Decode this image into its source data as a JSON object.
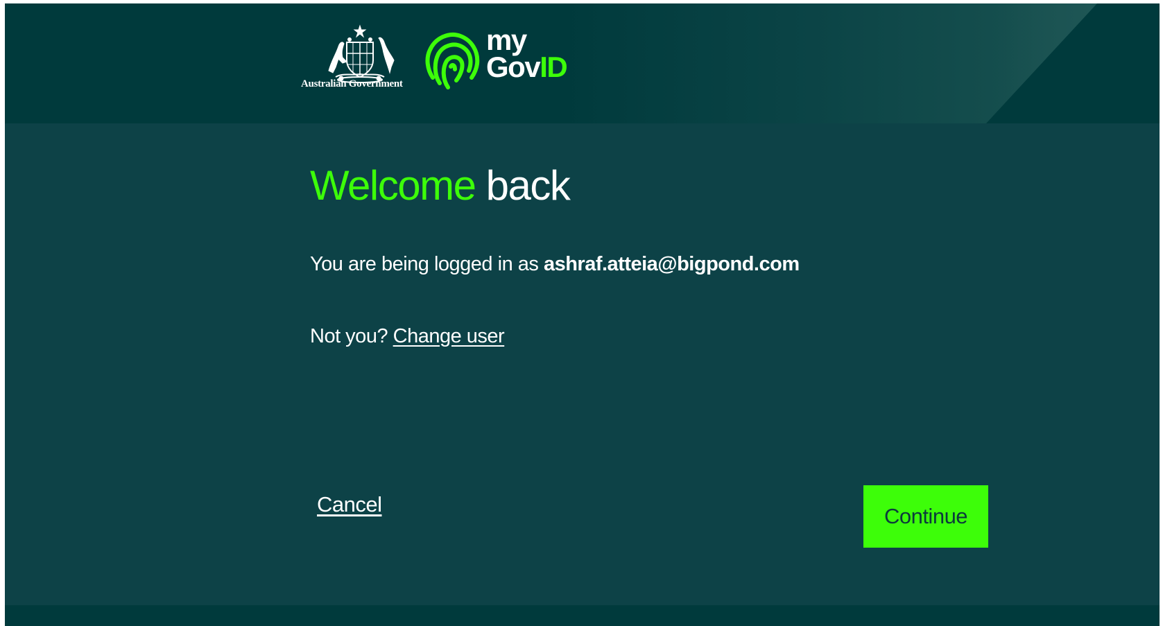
{
  "header": {
    "gov_logo_text": "Australian Government",
    "brand": {
      "my": "my",
      "gov": "Gov",
      "id": "ID"
    },
    "icons": [
      "coat-of-arms-icon",
      "fingerprint-icon"
    ]
  },
  "welcome": {
    "title_green": "Welcome",
    "title_white": "back",
    "logged_prefix": "You are being logged in as",
    "email": "ashraf.atteia@bigpond.com",
    "not_you": "Not you?",
    "change_user": "Change user"
  },
  "actions": {
    "cancel": "Cancel",
    "continue": "Continue"
  },
  "colors": {
    "accent": "#3dfe09",
    "background": "#0d4247",
    "header": "#003a3c"
  }
}
